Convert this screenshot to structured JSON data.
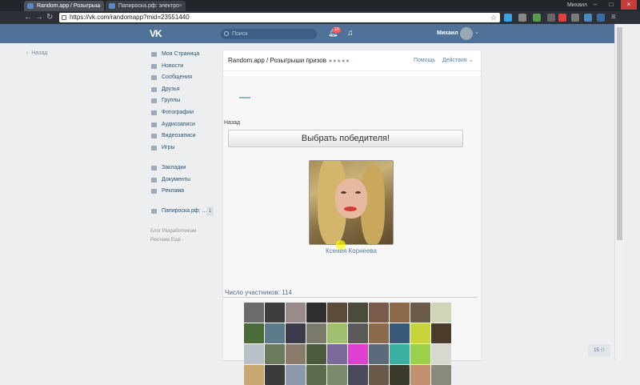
{
  "browser": {
    "tabs": [
      {
        "title": "Random.app / Розыгрыш"
      },
      {
        "title": "Папироска.рф: электро"
      }
    ],
    "profile_name": "Михаил",
    "url": "https://vk.com/randomapp?mid=23551440"
  },
  "header": {
    "logo": "VK",
    "search_placeholder": "Поиск",
    "notifications_count": "14",
    "user_name": "Михаил"
  },
  "left": {
    "back_label": "Назад"
  },
  "sidebar": {
    "items": [
      {
        "label": "Моя Страница",
        "icon": "home-icon"
      },
      {
        "label": "Новости",
        "icon": "news-icon"
      },
      {
        "label": "Сообщения",
        "icon": "message-icon"
      },
      {
        "label": "Друзья",
        "icon": "friends-icon"
      },
      {
        "label": "Группы",
        "icon": "groups-icon"
      },
      {
        "label": "Фотографии",
        "icon": "camera-icon"
      },
      {
        "label": "Аудиозаписи",
        "icon": "music-icon"
      },
      {
        "label": "Видеозаписи",
        "icon": "video-icon"
      },
      {
        "label": "Игры",
        "icon": "gamepad-icon"
      },
      {
        "label": "Закладки",
        "icon": "star-icon"
      },
      {
        "label": "Документы",
        "icon": "document-icon"
      },
      {
        "label": "Реклама",
        "icon": "megaphone-icon"
      },
      {
        "label": "Папироска.рф: ...",
        "icon": "group-icon"
      }
    ],
    "group_count": "1",
    "footer_line1": "Блог   Разработчикам",
    "footer_line2": "Реклама   Ещё ·"
  },
  "app": {
    "title": "Random.app / Розыгрыши призов",
    "rating": "★★★★★",
    "help": "Помощь",
    "actions": "Действия ⌄",
    "back": "Назад",
    "pick_winner": "Выбрать победителя!",
    "winner_name": "Ксения Корнеева",
    "participants": "Число участников: 114",
    "avatar_colors": [
      "#6b6b6b",
      "#3d3d3d",
      "#9a8b8b",
      "#2f2f2f",
      "#5a4b3b",
      "#4b4b3b",
      "#7a5b4b",
      "#8a6a4a",
      "#6b5b4b",
      "#cfd6b8",
      "#4a6a3a",
      "#5b7b8b",
      "#3b3b4b",
      "#7b7b6b",
      "#a0c070",
      "#5a5a5a",
      "#8b6b4b",
      "#3a5a7a",
      "#c8d23a",
      "#4b3b2b",
      "#b8c0c8",
      "#6a7a5a",
      "#8b7b6b",
      "#4a5a3a",
      "#7a6a9a",
      "#e040d0",
      "#5b6b7b",
      "#3ab0a0",
      "#9ad04a",
      "#d8d8d0",
      "#c8a870",
      "#3b3b3b",
      "#8a9aaa",
      "#5a6a4a",
      "#7b8b6b",
      "#4a4a5a",
      "#6a5a4a",
      "#3a3a2a",
      "#c09070",
      "#8a8a7a"
    ]
  },
  "corner_badge": "15 ⚇"
}
